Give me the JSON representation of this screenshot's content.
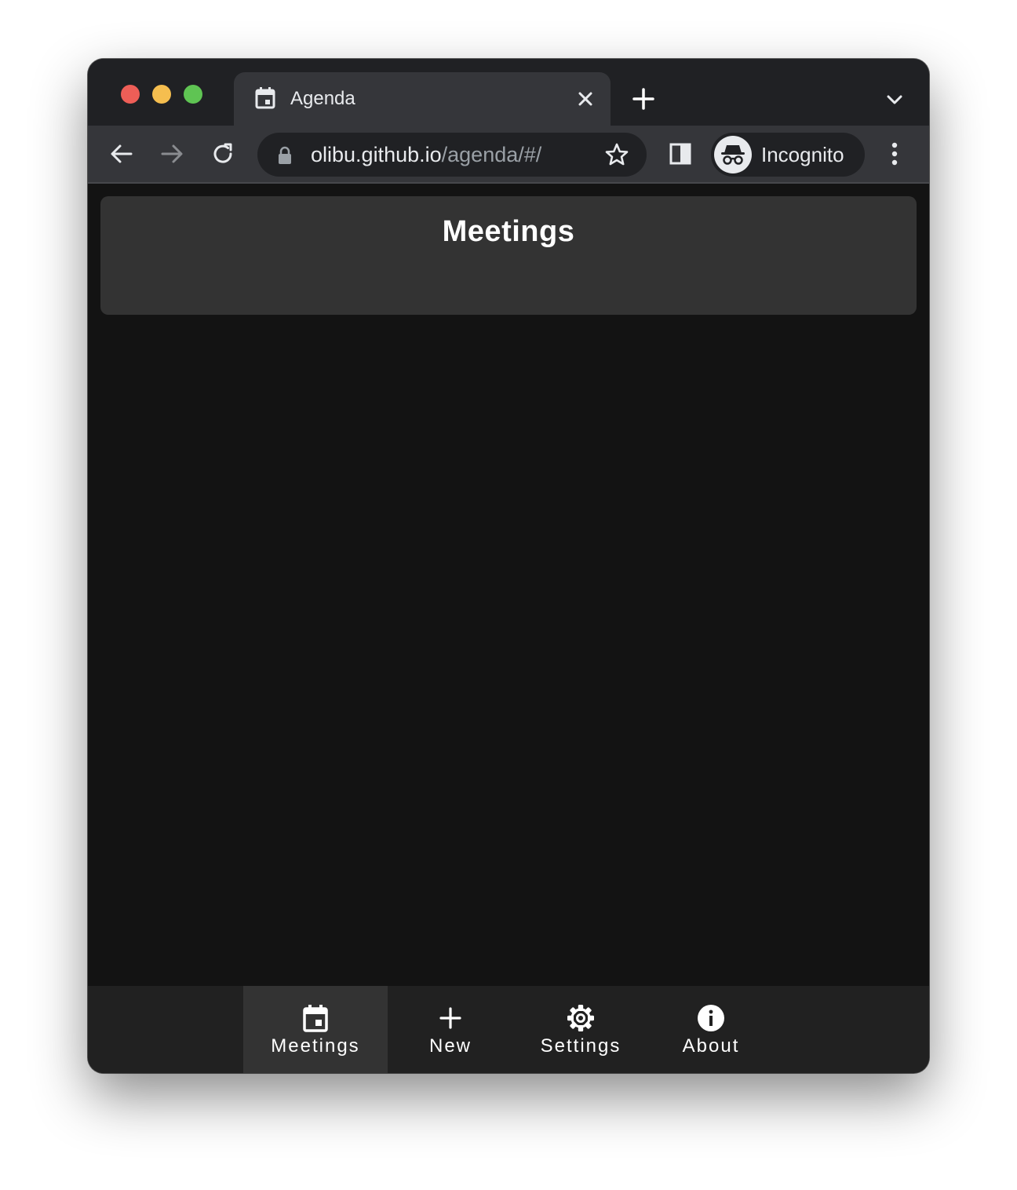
{
  "browser": {
    "tab": {
      "title": "Agenda",
      "icon": "calendar-icon"
    },
    "url": {
      "host": "olibu.github.io",
      "path": "/agenda/#/"
    },
    "profile_label": "Incognito"
  },
  "page": {
    "title": "Meetings"
  },
  "bottom_nav": {
    "items": [
      {
        "label": "Meetings",
        "icon": "calendar-icon",
        "active": true
      },
      {
        "label": "New",
        "icon": "plus-icon",
        "active": false
      },
      {
        "label": "Settings",
        "icon": "gear-icon",
        "active": false
      },
      {
        "label": "About",
        "icon": "info-icon",
        "active": false
      }
    ]
  },
  "colors": {
    "page_background": "#131313",
    "header_card": "#333333",
    "bottom_nav": "#212121",
    "active_nav_item": "#333333",
    "browser_frame": "#202124",
    "browser_toolbar": "#35363a"
  }
}
